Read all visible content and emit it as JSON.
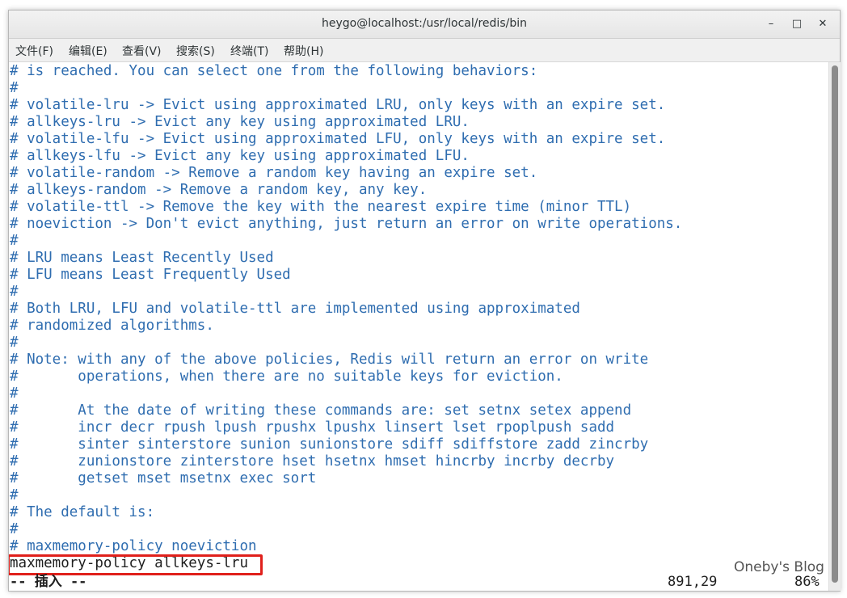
{
  "window": {
    "title": "heygo@localhost:/usr/local/redis/bin",
    "minimize_icon": "minimize-icon",
    "maximize_icon": "maximize-icon",
    "close_icon": "close-icon",
    "minimize_glyph": "–",
    "maximize_glyph": "□",
    "close_glyph": "✕"
  },
  "menu": [
    "文件(F)",
    "编辑(E)",
    "查看(V)",
    "搜索(S)",
    "终端(T)",
    "帮助(H)"
  ],
  "lines": [
    "# is reached. You can select one from the following behaviors:",
    "#",
    "# volatile-lru -> Evict using approximated LRU, only keys with an expire set.",
    "# allkeys-lru -> Evict any key using approximated LRU.",
    "# volatile-lfu -> Evict using approximated LFU, only keys with an expire set.",
    "# allkeys-lfu -> Evict any key using approximated LFU.",
    "# volatile-random -> Remove a random key having an expire set.",
    "# allkeys-random -> Remove a random key, any key.",
    "# volatile-ttl -> Remove the key with the nearest expire time (minor TTL)",
    "# noeviction -> Don't evict anything, just return an error on write operations.",
    "#",
    "# LRU means Least Recently Used",
    "# LFU means Least Frequently Used",
    "#",
    "# Both LRU, LFU and volatile-ttl are implemented using approximated",
    "# randomized algorithms.",
    "#",
    "# Note: with any of the above policies, Redis will return an error on write",
    "#       operations, when there are no suitable keys for eviction.",
    "#",
    "#       At the date of writing these commands are: set setnx setex append",
    "#       incr decr rpush lpush rpushx lpushx linsert lset rpoplpush sadd",
    "#       sinter sinterstore sunion sunionstore sdiff sdiffstore zadd zincrby",
    "#       zunionstore zinterstore hset hsetnx hmset hincrby incrby decrby",
    "#       getset mset msetnx exec sort",
    "#",
    "# The default is:",
    "#",
    "# maxmemory-policy noeviction",
    "maxmemory-policy allkeys-lru"
  ],
  "status": {
    "mode": "-- 插入 --",
    "position": "891,29",
    "percent": "86%"
  },
  "watermark": "Oneby's Blog",
  "colors": {
    "comment": "#2f6db0",
    "text": "#1f1f1f",
    "highlight_border": "#e0201b"
  }
}
